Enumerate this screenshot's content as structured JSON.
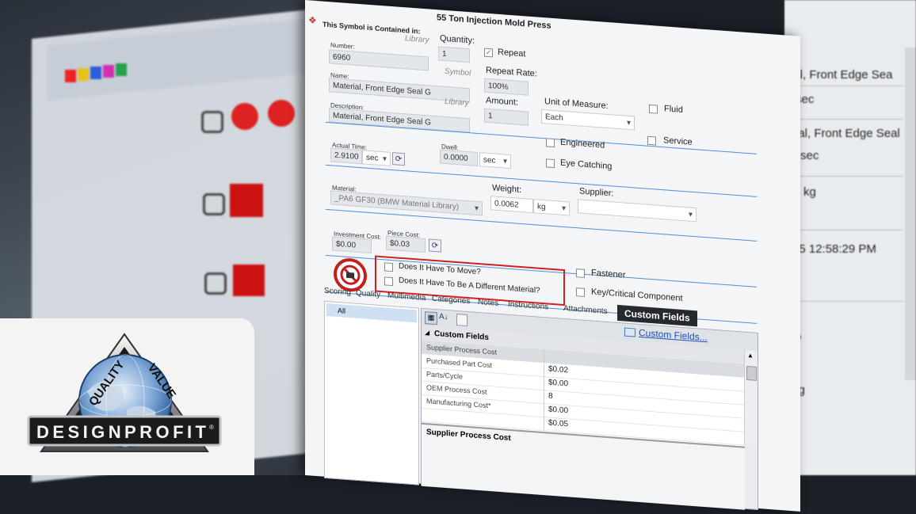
{
  "dialog": {
    "title": "55 Ton Injection Mold Press",
    "contained_in_label": "This Symbol is Contained in:",
    "number": {
      "label": "Number:",
      "tag": "Library",
      "value": "6960"
    },
    "name": {
      "label": "Name:",
      "tag": "Symbol",
      "value": "Material, Front Edge Seal G"
    },
    "description": {
      "label": "Description:",
      "tag": "Library",
      "value": "Material, Front Edge Seal G"
    },
    "quantity": {
      "label": "Quantity:",
      "value": "1"
    },
    "repeat": {
      "label": "Repeat",
      "checked": true
    },
    "repeat_rate": {
      "label": "Repeat Rate:",
      "value": "100%"
    },
    "amount": {
      "label": "Amount:",
      "value": "1"
    },
    "unit_of_measure": {
      "label": "Unit of Measure:",
      "value": "Each"
    },
    "fluid": {
      "label": "Fluid",
      "checked": false
    },
    "actual_time": {
      "label": "Actual Time:",
      "value": "2.9100",
      "unit": "sec"
    },
    "dwell": {
      "label": "Dwell:",
      "value": "0.0000",
      "unit": "sec"
    },
    "engineered": {
      "label": "Engineered",
      "checked": false
    },
    "service": {
      "label": "Service",
      "checked": false
    },
    "eye_catching": {
      "label": "Eye Catching",
      "checked": false
    },
    "material": {
      "label": "Material:",
      "value": "_PA6 GF30 (BMW Material Library)"
    },
    "weight": {
      "label": "Weight:",
      "value": "0.0062",
      "unit": "kg"
    },
    "supplier": {
      "label": "Supplier:",
      "value": ""
    },
    "investment_cost": {
      "label": "Investment Cost:",
      "value": "$0.00"
    },
    "piece_cost": {
      "label": "Piece Cost:",
      "value": "$0.03"
    },
    "question_move": "Does It Have To Move?",
    "question_material": "Does It Have To Be A Different Material?",
    "fastener": {
      "label": "Fastener",
      "checked": false
    },
    "key_component": {
      "label": "Key/Critical Component",
      "checked": false
    },
    "tabs": [
      "Scoring",
      "Quality",
      "Multimedia",
      "Categories",
      "Notes",
      "Instructions",
      "Attachments",
      "Custom Fields"
    ],
    "active_tab": "Custom Fields",
    "left_list_item": "All",
    "custom_fields_link": "Custom Fields...",
    "grid_category": "Custom Fields",
    "grid_rows": [
      {
        "name": "Supplier Process Cost",
        "value": ""
      },
      {
        "name": "Purchased Part Cost",
        "value": "$0.02"
      },
      {
        "name": "Parts/Cycle",
        "value": "$0.00"
      },
      {
        "name": "OEM Process Cost",
        "value": "8"
      },
      {
        "name": "Manufacturing Cost*",
        "value": "$0.00"
      },
      {
        "name": "",
        "value": "$0.05"
      }
    ],
    "grid_footer": "Supplier Process Cost"
  },
  "right_window": {
    "rows": [
      "ial, Front Edge Sea",
      "sec",
      "ial, Front Edge Seal",
      "sec",
      "kg",
      "15 12:58:29 PM",
      "%",
      "kg"
    ]
  },
  "logo": {
    "brand": "DESIGNPROFIT",
    "registered": "®",
    "arc_left": "QUALITY",
    "arc_right": "VALUE"
  },
  "colors": {
    "accent_blue": "#4a8fd4",
    "highlight_red": "#d21f1f",
    "active_tab_bg": "#262a30"
  }
}
